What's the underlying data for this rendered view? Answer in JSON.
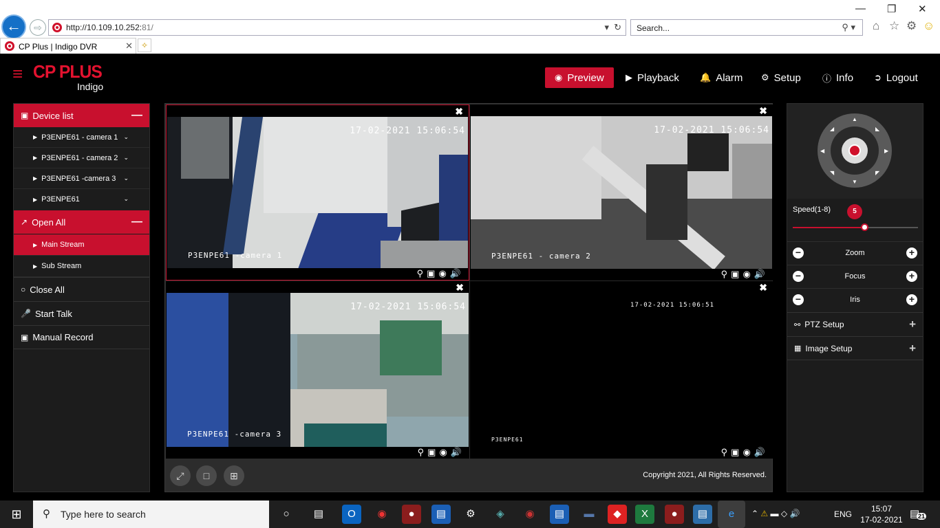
{
  "browser": {
    "url_host": "http://10.109.10.252:",
    "url_port": "81/",
    "search_placeholder": "Search...",
    "tab_title": "CP Plus | Indigo DVR"
  },
  "brand": {
    "name": "CP PLUS",
    "product": "Indigo",
    "accent": "#c8102e"
  },
  "nav": {
    "preview": "Preview",
    "playback": "Playback",
    "alarm": "Alarm",
    "setup": "Setup",
    "info": "Info",
    "logout": "Logout",
    "active": "Preview"
  },
  "sidebar": {
    "device_list": "Device list",
    "devices": [
      "P3ENPE61 - camera 1",
      "P3ENPE61 - camera 2",
      "P3ENPE61 -camera 3",
      "P3ENPE61"
    ],
    "open_all": "Open All",
    "main_stream": "Main Stream",
    "sub_stream": "Sub Stream",
    "close_all": "Close All",
    "start_talk": "Start Talk",
    "manual_record": "Manual Record"
  },
  "tiles": [
    {
      "timestamp": "17-02-2021 15:06:54",
      "label": "P3ENPE61   -camera 1"
    },
    {
      "timestamp": "17-02-2021 15:06:54",
      "label": "P3ENPE61  - camera 2"
    },
    {
      "timestamp": "17-02-2021 15:06:54",
      "label": "P3ENPE61  -camera 3"
    },
    {
      "timestamp": "17-02-2021 15:06:51",
      "label": "P3ENPE61"
    }
  ],
  "footer": {
    "copyright": "Copyright 2021, All Rights Reserved."
  },
  "ptz": {
    "speed_label": "Speed(1-8)",
    "speed_value": "5",
    "speed_fraction": 0.57,
    "zoom": "Zoom",
    "focus": "Focus",
    "iris": "Iris",
    "ptz_setup": "PTZ Setup",
    "image_setup": "Image Setup"
  },
  "taskbar": {
    "search_placeholder": "Type here to search",
    "language": "ENG",
    "time": "15:07",
    "date": "17-02-2021",
    "notifications": "21"
  }
}
